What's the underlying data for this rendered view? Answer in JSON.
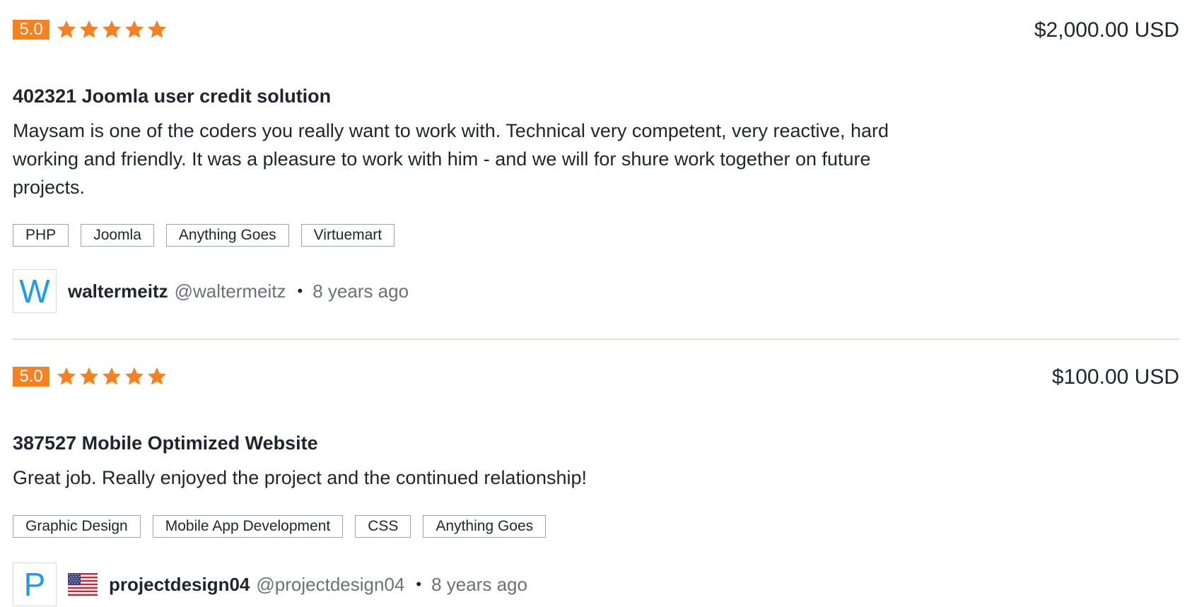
{
  "reviews": [
    {
      "rating": "5.0",
      "stars": 5,
      "amount": "$2,000.00 USD",
      "title": "402321 Joomla user credit solution",
      "comment": "Maysam is one of the coders you really want to work with. Technical very competent, very reactive, hard working and friendly. It was a pleasure to work with him - and we will for shure work together on future projects.",
      "tags": [
        "PHP",
        "Joomla",
        "Anything Goes",
        "Virtuemart"
      ],
      "author": {
        "avatar_letter": "W",
        "name": "waltermeitz",
        "handle": "@waltermeitz",
        "time": "8 years ago",
        "flag": null
      }
    },
    {
      "rating": "5.0",
      "stars": 5,
      "amount": "$100.00 USD",
      "title": "387527 Mobile Optimized Website",
      "comment": "Great job. Really enjoyed the project and the continued relationship!",
      "tags": [
        "Graphic Design",
        "Mobile App Development",
        "CSS",
        "Anything Goes"
      ],
      "author": {
        "avatar_letter": "P",
        "name": "projectdesign04",
        "handle": "@projectdesign04",
        "time": "8 years ago",
        "flag": "us-flag-icon"
      }
    }
  ],
  "separator": "•",
  "colors": {
    "rating_badge": "#f7801f",
    "star": "#f7801f",
    "avatar_letter": "#1e9ce4",
    "text_primary": "#1f2430",
    "text_muted": "#6b707a",
    "tag_border": "#9ea3ab",
    "divider": "#dcdfe3"
  }
}
